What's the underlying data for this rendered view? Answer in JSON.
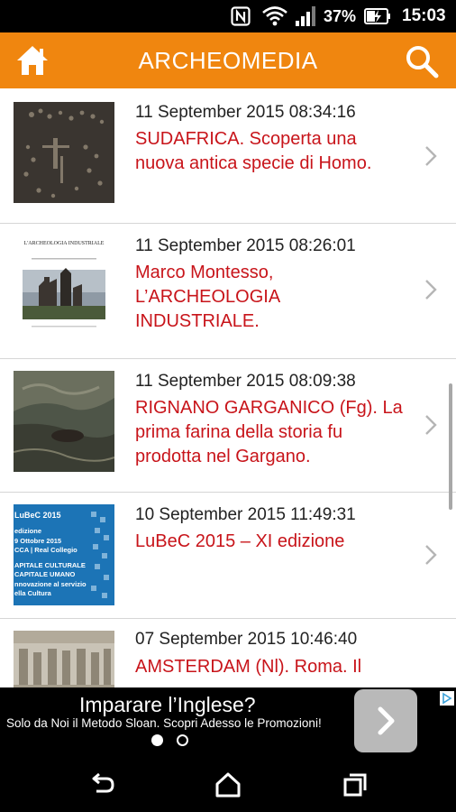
{
  "status_bar": {
    "battery_percent": "37%",
    "time": "15:03",
    "icons": [
      "nfc-icon",
      "wifi-icon",
      "signal-icon",
      "battery-charging-icon"
    ]
  },
  "app_bar": {
    "title": "ARCHEOMEDIA",
    "color": "#f0860f",
    "icons": [
      "home-icon",
      "search-icon"
    ]
  },
  "articles": [
    {
      "date": "11 September 2015 08:34:16",
      "title": "SUDAFRICA. Scoperta una nuova antica specie di Homo."
    },
    {
      "date": "11 September 2015 08:26:01",
      "title": "Marco Montesso, L’ARCHEOLOGIA INDUSTRIALE.",
      "thumb_caption": "L'ARCHEOLOGIA INDUSTRIALE"
    },
    {
      "date": "11 September 2015 08:09:38",
      "title": "RIGNANO GARGANICO (Fg). La prima farina della storia fu prodotta nel Gargano."
    },
    {
      "date": "10 September 2015 11:49:31",
      "title": "LuBeC 2015 – XI edizione",
      "thumb_lines": [
        "LuBeC 2015",
        "edizione",
        "9 Ottobre 2015",
        "CCA | Real Collegio",
        "APITALE CULTURALE",
        "CAPITALE UMANO",
        "nnovazione al servizio",
        "ella Cultura"
      ]
    },
    {
      "date": "07 September 2015 10:46:40",
      "title": "AMSTERDAM (Nl). Roma. Il"
    }
  ],
  "headline_color": "#c8141a",
  "ad": {
    "title": "Imparare l’Inglese?",
    "subtitle": "Solo da Noi il Metodo Sloan. Scopri Adesso le Promozioni!",
    "icons": [
      "ad-choices-icon",
      "chevron-right-icon"
    ]
  },
  "nav_bar": {
    "icons": [
      "back-icon",
      "home-icon",
      "recents-icon"
    ]
  }
}
